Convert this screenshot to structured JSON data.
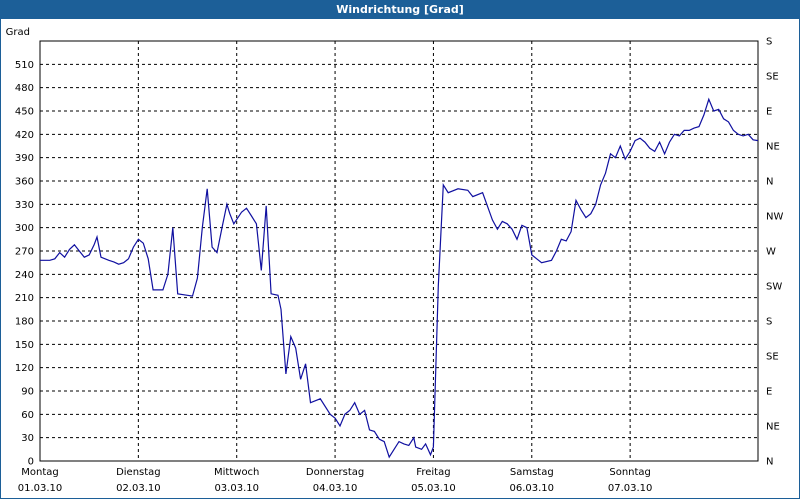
{
  "window": {
    "title": "Windrichtung [Grad]"
  },
  "chart_data": {
    "type": "line",
    "title": "Windrichtung [Grad]",
    "ylabel": "Grad",
    "ylim": [
      0,
      540
    ],
    "yticks": [
      0,
      30,
      60,
      90,
      120,
      150,
      180,
      210,
      240,
      270,
      300,
      330,
      360,
      390,
      420,
      450,
      480,
      510
    ],
    "right_ticks": [
      {
        "value": 0,
        "label": "N"
      },
      {
        "value": 45,
        "label": "NE"
      },
      {
        "value": 90,
        "label": "E"
      },
      {
        "value": 135,
        "label": "SE"
      },
      {
        "value": 180,
        "label": "S"
      },
      {
        "value": 225,
        "label": "SW"
      },
      {
        "value": 270,
        "label": "W"
      },
      {
        "value": 315,
        "label": "NW"
      },
      {
        "value": 360,
        "label": "N"
      },
      {
        "value": 405,
        "label": "NE"
      },
      {
        "value": 450,
        "label": "E"
      },
      {
        "value": 495,
        "label": "SE"
      },
      {
        "value": 540,
        "label": "S"
      }
    ],
    "xlim": [
      0,
      7
    ],
    "xticks": [
      {
        "day": "Montag",
        "date": "01.03.10"
      },
      {
        "day": "Dienstag",
        "date": "02.03.10"
      },
      {
        "day": "Mittwoch",
        "date": "03.03.10"
      },
      {
        "day": "Donnerstag",
        "date": "04.03.10"
      },
      {
        "day": "Freitag",
        "date": "05.03.10"
      },
      {
        "day": "Samstag",
        "date": "06.03.10"
      },
      {
        "day": "Sonntag",
        "date": "07.03.10"
      }
    ],
    "grid": true,
    "series": [
      {
        "color": "#1010a0",
        "points": [
          [
            0.0,
            258
          ],
          [
            0.1,
            258
          ],
          [
            0.15,
            260
          ],
          [
            0.2,
            268
          ],
          [
            0.25,
            262
          ],
          [
            0.3,
            272
          ],
          [
            0.35,
            278
          ],
          [
            0.4,
            270
          ],
          [
            0.45,
            262
          ],
          [
            0.5,
            265
          ],
          [
            0.55,
            278
          ],
          [
            0.58,
            288
          ],
          [
            0.62,
            262
          ],
          [
            0.7,
            258
          ],
          [
            0.75,
            256
          ],
          [
            0.8,
            253
          ],
          [
            0.85,
            255
          ],
          [
            0.9,
            260
          ],
          [
            0.95,
            275
          ],
          [
            1.0,
            285
          ],
          [
            1.05,
            280
          ],
          [
            1.1,
            260
          ],
          [
            1.15,
            220
          ],
          [
            1.25,
            220
          ],
          [
            1.3,
            240
          ],
          [
            1.35,
            300
          ],
          [
            1.4,
            215
          ],
          [
            1.5,
            213
          ],
          [
            1.55,
            212
          ],
          [
            1.6,
            235
          ],
          [
            1.65,
            300
          ],
          [
            1.7,
            350
          ],
          [
            1.75,
            275
          ],
          [
            1.8,
            268
          ],
          [
            1.85,
            300
          ],
          [
            1.9,
            330
          ],
          [
            1.93,
            318
          ],
          [
            1.97,
            305
          ],
          [
            2.05,
            320
          ],
          [
            2.1,
            325
          ],
          [
            2.15,
            315
          ],
          [
            2.2,
            305
          ],
          [
            2.25,
            245
          ],
          [
            2.3,
            328
          ],
          [
            2.35,
            215
          ],
          [
            2.42,
            213
          ],
          [
            2.45,
            195
          ],
          [
            2.5,
            112
          ],
          [
            2.55,
            160
          ],
          [
            2.6,
            145
          ],
          [
            2.65,
            105
          ],
          [
            2.7,
            125
          ],
          [
            2.75,
            75
          ],
          [
            2.85,
            80
          ],
          [
            2.95,
            60
          ],
          [
            3.0,
            55
          ],
          [
            3.05,
            45
          ],
          [
            3.1,
            60
          ],
          [
            3.15,
            65
          ],
          [
            3.2,
            75
          ],
          [
            3.25,
            60
          ],
          [
            3.3,
            65
          ],
          [
            3.35,
            40
          ],
          [
            3.4,
            38
          ],
          [
            3.45,
            28
          ],
          [
            3.5,
            25
          ],
          [
            3.55,
            5
          ],
          [
            3.6,
            15
          ],
          [
            3.65,
            25
          ],
          [
            3.7,
            22
          ],
          [
            3.75,
            20
          ],
          [
            3.8,
            30
          ],
          [
            3.82,
            18
          ],
          [
            3.88,
            15
          ],
          [
            3.92,
            22
          ],
          [
            3.97,
            8
          ],
          [
            4.0,
            18
          ],
          [
            4.05,
            225
          ],
          [
            4.1,
            355
          ],
          [
            4.15,
            345
          ],
          [
            4.25,
            350
          ],
          [
            4.35,
            348
          ],
          [
            4.4,
            340
          ],
          [
            4.5,
            345
          ],
          [
            4.6,
            310
          ],
          [
            4.65,
            298
          ],
          [
            4.7,
            308
          ],
          [
            4.75,
            305
          ],
          [
            4.8,
            298
          ],
          [
            4.85,
            285
          ],
          [
            4.9,
            303
          ],
          [
            4.95,
            300
          ],
          [
            5.0,
            265
          ],
          [
            5.05,
            260
          ],
          [
            5.1,
            255
          ],
          [
            5.2,
            258
          ],
          [
            5.25,
            270
          ],
          [
            5.3,
            285
          ],
          [
            5.35,
            283
          ],
          [
            5.4,
            295
          ],
          [
            5.45,
            335
          ],
          [
            5.5,
            323
          ],
          [
            5.55,
            313
          ],
          [
            5.6,
            318
          ],
          [
            5.65,
            330
          ],
          [
            5.7,
            355
          ],
          [
            5.75,
            370
          ],
          [
            5.8,
            395
          ],
          [
            5.85,
            390
          ],
          [
            5.9,
            405
          ],
          [
            5.95,
            388
          ],
          [
            6.0,
            398
          ],
          [
            6.05,
            412
          ],
          [
            6.1,
            415
          ],
          [
            6.15,
            410
          ],
          [
            6.2,
            402
          ],
          [
            6.25,
            398
          ],
          [
            6.3,
            410
          ],
          [
            6.35,
            395
          ],
          [
            6.4,
            410
          ],
          [
            6.45,
            420
          ],
          [
            6.5,
            418
          ],
          [
            6.55,
            425
          ],
          [
            6.6,
            425
          ],
          [
            6.65,
            428
          ],
          [
            6.7,
            430
          ],
          [
            6.75,
            445
          ],
          [
            6.8,
            465
          ],
          [
            6.85,
            450
          ],
          [
            6.9,
            452
          ],
          [
            6.95,
            440
          ],
          [
            7.0,
            436
          ],
          [
            7.05,
            425
          ],
          [
            7.1,
            420
          ],
          [
            7.15,
            418
          ],
          [
            7.2,
            420
          ],
          [
            7.25,
            413
          ],
          [
            7.3,
            412
          ]
        ]
      }
    ]
  }
}
